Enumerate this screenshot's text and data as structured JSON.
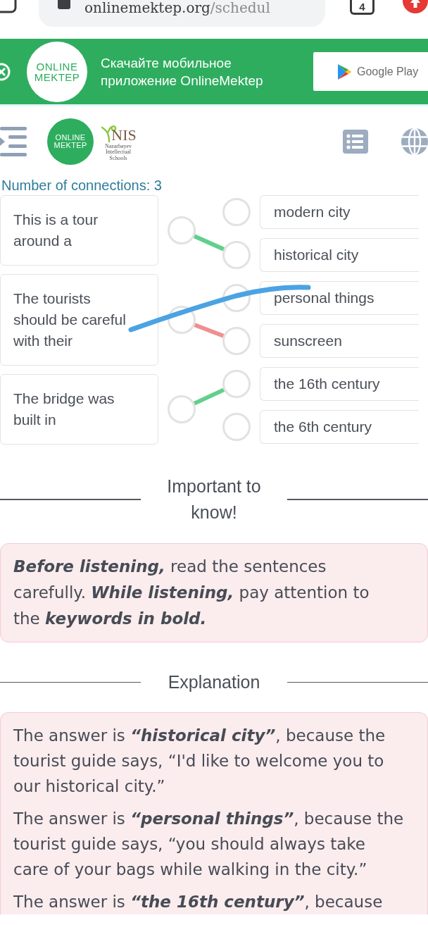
{
  "browser_bar": {
    "url_host": "onlinemektep.org",
    "url_path": "/schedul",
    "tab_count": "4"
  },
  "app_banner": {
    "logo": "ONLINE MEKTEP",
    "message": "Скачайте мобильное приложение OnlineMektep",
    "store_button": "Google Play"
  },
  "header": {
    "logo": "ONLINE MEKTEP",
    "partner_logo": {
      "wordmark": "NIS",
      "subtitle": "Nazarbayev Intellectual Schools"
    }
  },
  "matching": {
    "counter": "Number of connections: 3",
    "prompts": [
      {
        "text": "This is a tour around a",
        "linked": true,
        "correct": true
      },
      {
        "text": "The tourists should be careful with their",
        "linked": true,
        "correct": false
      },
      {
        "text": "The bridge was built in",
        "linked": true,
        "correct": true
      }
    ],
    "options": [
      {
        "text": "modern city",
        "linked": false
      },
      {
        "text": "historical city",
        "linked": true
      },
      {
        "text": "personal things",
        "linked": false
      },
      {
        "text": "sunscreen",
        "linked": true
      },
      {
        "text": "the 16th century",
        "linked": true
      },
      {
        "text": "the 6th century",
        "linked": false
      }
    ]
  },
  "tip": {
    "title": "Important to know!",
    "text": "**Before listening,** read the sentences carefully. **While listening,** pay attention to the **keywords in bold.**"
  },
  "explanation": {
    "title": "Explanation",
    "paragraphs": [
      "The answer is **“historical city”**, because the tourist guide says, “I'd like to welcome you to our historical city.”",
      "The answer is **“personal things”**, because the tourist guide says, “you should always take care of your bags while walking in the city.”",
      "The answer is **“the 16th century”**, because"
    ]
  }
}
